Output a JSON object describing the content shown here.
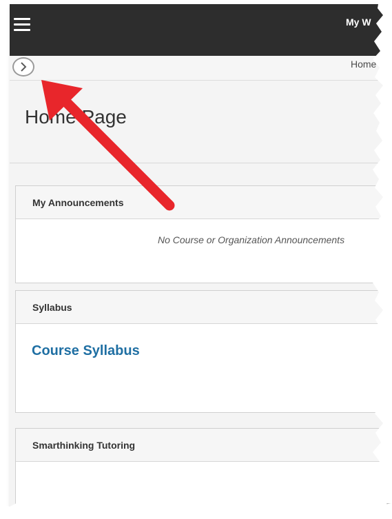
{
  "topbar": {
    "title": "My W"
  },
  "breadcrumb": {
    "home_label": "Home"
  },
  "page": {
    "title": "Home Page"
  },
  "modules": {
    "announcements": {
      "header": "My Announcements",
      "empty_message": "No Course or Organization Announcements"
    },
    "syllabus": {
      "header": "Syllabus",
      "link_label": "Course Syllabus"
    },
    "smarthinking": {
      "header": "Smarthinking Tutoring"
    }
  },
  "icons": {
    "menu": "hamburger-menu-icon",
    "nav_toggle": "chevron-right-icon"
  },
  "colors": {
    "topbar": "#2d2d2d",
    "link": "#1f6fa3",
    "annotation_arrow": "#e8262b"
  }
}
